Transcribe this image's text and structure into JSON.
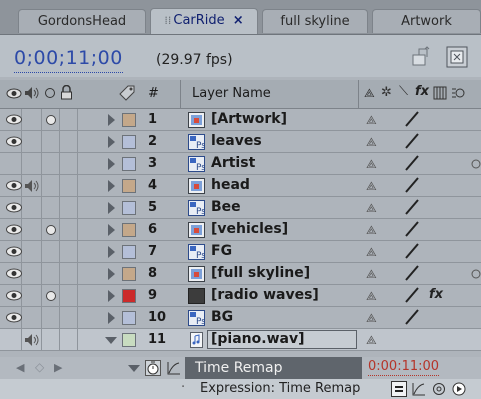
{
  "tabs": [
    {
      "label": "GordonsHead",
      "active": false
    },
    {
      "label": "CarRide",
      "active": true,
      "close": "×"
    },
    {
      "label": "full skyline",
      "active": false
    },
    {
      "label": "Artwork",
      "active": false
    }
  ],
  "timebar": {
    "timecode": "0;00;11;00",
    "fps": "(29.97 fps)"
  },
  "header": {
    "number_col": "#",
    "layer_name_col": "Layer Name"
  },
  "layers": [
    {
      "num": "1",
      "name": "[Artwork]",
      "type": "comp",
      "label_color": "#c4a88a",
      "eye": true,
      "solo": true,
      "audio": false,
      "quality": true,
      "fx": false
    },
    {
      "num": "2",
      "name": "leaves",
      "type": "footage",
      "label_color": "#b4bfd8",
      "eye": true,
      "solo": false,
      "audio": false,
      "quality": true,
      "fx": false
    },
    {
      "num": "3",
      "name": "Artist",
      "type": "footage",
      "label_color": "#b4bfd8",
      "eye": false,
      "solo": false,
      "audio": false,
      "quality": true,
      "fx": false
    },
    {
      "num": "4",
      "name": "head",
      "type": "comp",
      "label_color": "#c4a88a",
      "eye": true,
      "solo": false,
      "audio": true,
      "quality": true,
      "fx": false
    },
    {
      "num": "5",
      "name": "Bee",
      "type": "footage",
      "label_color": "#b4bfd8",
      "eye": true,
      "solo": false,
      "audio": false,
      "quality": true,
      "fx": false
    },
    {
      "num": "6",
      "name": "[vehicles]",
      "type": "comp",
      "label_color": "#c4a88a",
      "eye": true,
      "solo": true,
      "audio": false,
      "quality": true,
      "fx": false
    },
    {
      "num": "7",
      "name": "FG",
      "type": "footage",
      "label_color": "#b4bfd8",
      "eye": true,
      "solo": false,
      "audio": false,
      "quality": true,
      "fx": false
    },
    {
      "num": "8",
      "name": "[full skyline]",
      "type": "comp",
      "label_color": "#c4a88a",
      "eye": true,
      "solo": false,
      "audio": false,
      "quality": true,
      "fx": false
    },
    {
      "num": "9",
      "name": "[radio waves]",
      "type": "solid",
      "label_color": "#cc2a2a",
      "eye": true,
      "solo": true,
      "audio": false,
      "quality": true,
      "fx": true
    },
    {
      "num": "10",
      "name": "BG",
      "type": "footage",
      "label_color": "#b4bfd8",
      "eye": true,
      "solo": false,
      "audio": false,
      "quality": true,
      "fx": false
    },
    {
      "num": "11",
      "name": "[piano.wav]",
      "type": "audio",
      "label_color": "#c8dcc0",
      "eye": false,
      "solo": false,
      "audio": true,
      "quality": false,
      "fx": false,
      "selected": true,
      "expanded": true
    }
  ],
  "time_remap": {
    "label": "Time Remap",
    "value": "0:00:11:00"
  },
  "expression": {
    "label": "Expression: Time Remap"
  },
  "icons": {
    "tab_grip": "grip-icon",
    "flowchart": "flowchart-icon",
    "comp_mini": "comp-mini-icon",
    "video": "eye-icon",
    "audio": "speaker-icon",
    "solo": "solo-icon",
    "lock": "lock-icon",
    "label": "label-tag-icon",
    "shy": "shy-icon",
    "collapse": "collapse-icon",
    "quality": "quality-icon",
    "effect": "fx-icon",
    "frame_blend": "frame-blend-icon",
    "motion_blur": "motion-blur-icon",
    "stopwatch": "stopwatch-icon",
    "graph": "graph-icon",
    "keyframe_nav": "keyframe-nav-icon",
    "expression_enable": "equals-icon",
    "expression_graph": "expression-graph-icon",
    "pickwhip": "pickwhip-icon",
    "expression_menu": "expression-menu-icon"
  }
}
